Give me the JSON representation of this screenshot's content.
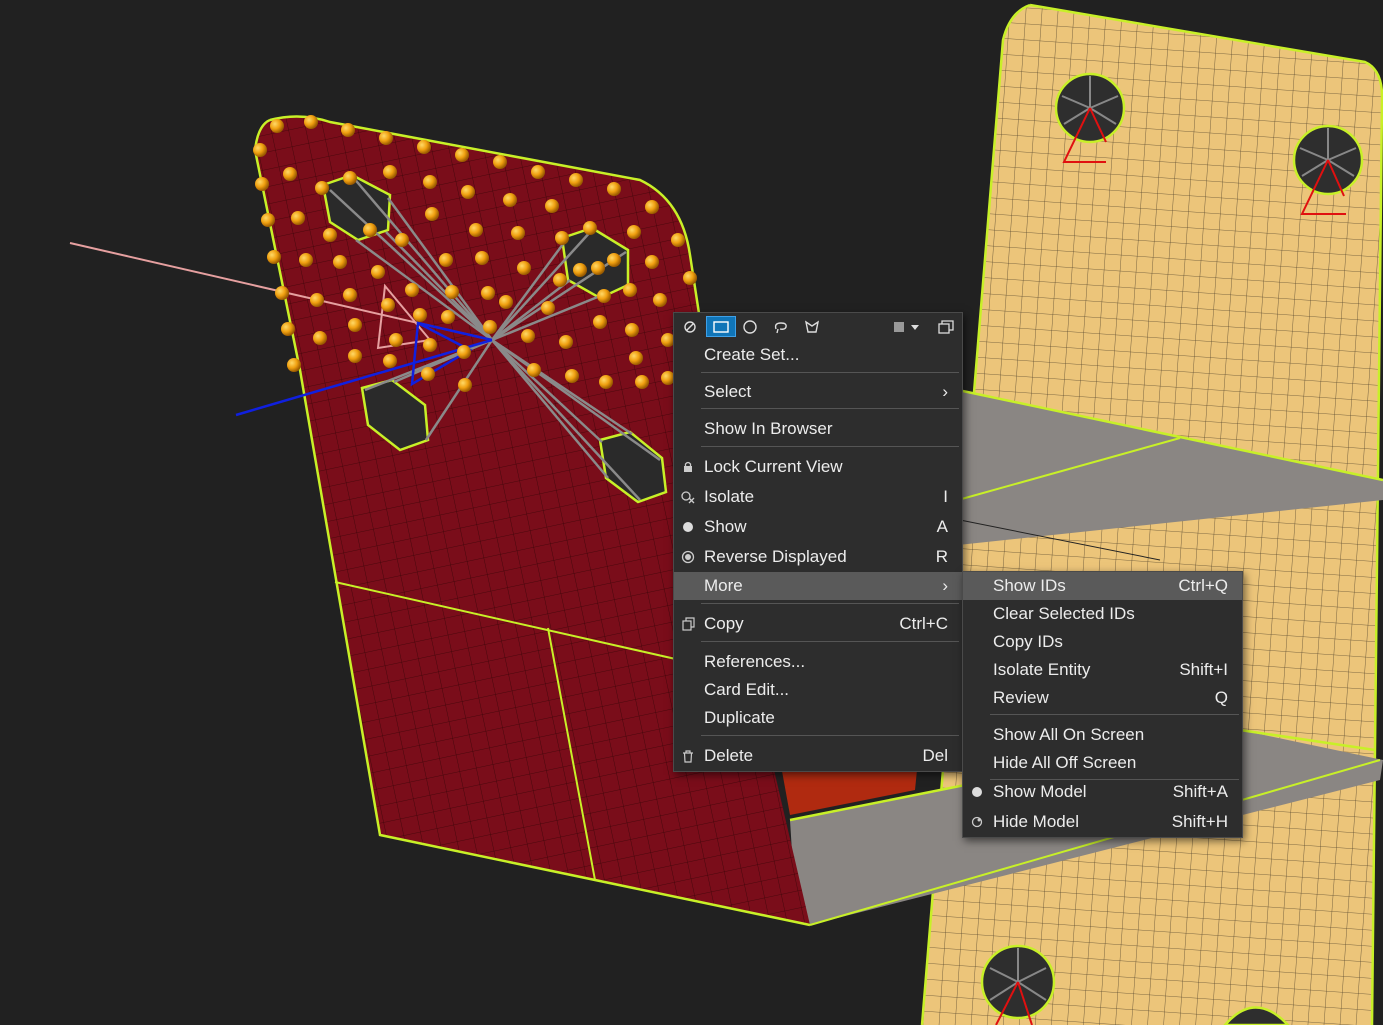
{
  "context_menu": {
    "toolbar_icons": [
      "unselect-icon",
      "box-select-icon",
      "circle-select-icon",
      "lasso-select-icon",
      "polygon-select-icon",
      "square-icon",
      "dropdown-icon",
      "copy-window-icon"
    ],
    "items": [
      {
        "label": "Create Set...",
        "shortcut": ""
      },
      {
        "label": "Select",
        "shortcut": "›"
      },
      {
        "label": "Show In Browser",
        "shortcut": ""
      },
      {
        "label": "Lock Current View",
        "shortcut": ""
      },
      {
        "label": "Isolate",
        "shortcut": "I"
      },
      {
        "label": "Show",
        "shortcut": "A"
      },
      {
        "label": "Reverse Displayed",
        "shortcut": "R"
      },
      {
        "label": "More",
        "shortcut": "›"
      },
      {
        "label": "Copy",
        "shortcut": "Ctrl+C"
      },
      {
        "label": "References...",
        "shortcut": ""
      },
      {
        "label": "Card Edit...",
        "shortcut": ""
      },
      {
        "label": "Duplicate",
        "shortcut": ""
      },
      {
        "label": "Delete",
        "shortcut": "Del"
      }
    ]
  },
  "submenu": {
    "items": [
      {
        "label": "Show IDs",
        "shortcut": "Ctrl+Q"
      },
      {
        "label": "Clear Selected IDs",
        "shortcut": ""
      },
      {
        "label": "Copy IDs",
        "shortcut": ""
      },
      {
        "label": "Isolate Entity",
        "shortcut": "Shift+I"
      },
      {
        "label": "Review",
        "shortcut": "Q"
      },
      {
        "label": "Show All On Screen",
        "shortcut": ""
      },
      {
        "label": "Hide All Off Screen",
        "shortcut": ""
      },
      {
        "label": "Show Model",
        "shortcut": "Shift+A"
      },
      {
        "label": "Hide Model",
        "shortcut": "Shift+H"
      }
    ]
  },
  "colors": {
    "background": "#212121",
    "dark_part": "#7a0d1a",
    "light_part": "#ecc57a",
    "edge_highlight": "#c8f028",
    "node": "#f0a010",
    "menu_bg": "#2d2d2d",
    "menu_highlight": "#5a5a5a",
    "accent": "#1075b8"
  }
}
